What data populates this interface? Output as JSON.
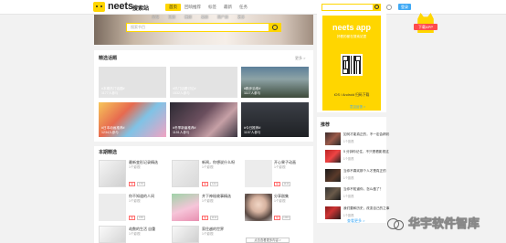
{
  "header": {
    "logo_text": "neets",
    "logo_sub": "搜索站",
    "nav": [
      "首页",
      "回响推荐",
      "标签",
      "最新",
      "任务"
    ],
    "login": "登录",
    "corner_app": "下载APP"
  },
  "hero": {
    "categories": [
      "全部",
      "日剧",
      "韩剧",
      "美剧",
      "国产剧",
      "更多"
    ],
    "search_placeholder": "搜索节目"
  },
  "featured": {
    "title": "精选话题",
    "more": "更多 >",
    "tiles": [
      {
        "t1": "#本期热门话题#",
        "t2": "1177人参与"
      },
      {
        "t1": "#热门话题讨论#",
        "t2": "1532人参与"
      },
      {
        "t1": "#跑步治愈#",
        "t2": "1117人参与"
      },
      {
        "t1": "#日本动画推荐#",
        "t2": "1234人参与"
      },
      {
        "t1": "#冬季新番推荐#",
        "t2": "1151人参与"
      },
      {
        "t1": "#今日推荐#",
        "t2": "1157人参与"
      }
    ]
  },
  "picks": {
    "title": "本期精选",
    "items": [
      {
        "title": "最新变形记录精选",
        "meta": "1个影视",
        "badge": "170"
      },
      {
        "title": "新闻，你想说什么呀",
        "meta": "1个影视",
        "badge": "144"
      },
      {
        "title": "开心果子动画",
        "meta": "1个影视",
        "badge": "1111"
      },
      {
        "title": "你不知道的人间",
        "meta": "1个影视",
        "badge": "155"
      },
      {
        "title": "井下神秘故事精选",
        "meta": "1个影视",
        "badge": "1111"
      },
      {
        "title": "分享剧集",
        "meta": "1个影视",
        "badge": "1001"
      },
      {
        "title": "劫数的生活 自重",
        "meta": "1个影视",
        "badge": "155"
      },
      {
        "title": "家住越的世界",
        "meta": "1个影视",
        "badge": "158"
      }
    ],
    "load_more": "点击查看更多内容 >"
  },
  "app": {
    "title": "neets app",
    "subtitle": "好看的都在搜索站里",
    "download": "iOS / Android 扫码下载",
    "feedback": "意见反馈 >"
  },
  "recommend": {
    "title": "推荐",
    "items": [
      {
        "text": "如何才能真正的，不一定会精彩",
        "meta": "1个影视"
      },
      {
        "text": "5 分钟你记住，不只是看影视这",
        "meta": "1个影视"
      },
      {
        "text": "当你不喜欢那个人才是真正的",
        "meta": "1个影视"
      },
      {
        "text": "当你不知道你，怎么做了？",
        "meta": "1个影视"
      },
      {
        "text": "我们要和历史，改变自己的之事",
        "meta": "1个影视"
      }
    ],
    "more": "查看更多 >"
  },
  "watermark": "华宇软件智库",
  "colors": {
    "accent": "#ffd600",
    "blue": "#3fa9f5",
    "red": "#ff4c4c"
  }
}
